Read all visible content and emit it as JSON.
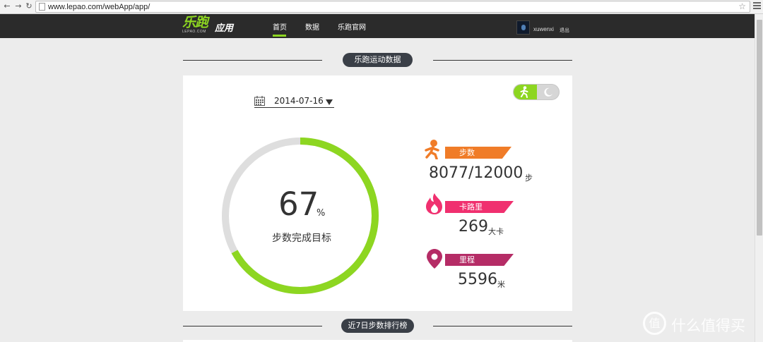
{
  "browser": {
    "url": "www.lepao.com/webApp/app/"
  },
  "header": {
    "logo_main": "乐跑",
    "logo_sub": "LEPAO.COM",
    "logo_app": "应用",
    "nav": [
      {
        "label": "首页",
        "active": true
      },
      {
        "label": "数据",
        "active": false
      },
      {
        "label": "乐跑官网",
        "active": false
      }
    ],
    "username": "xuwenxi",
    "logout_label": "退出"
  },
  "section1": {
    "title": "乐跑运动数据"
  },
  "card": {
    "date": "2014-07-16",
    "progress": {
      "value": "67",
      "unit": "%",
      "fraction": 0.67,
      "label": "步数完成目标"
    },
    "stats": [
      {
        "label": "步数",
        "value": "8077/12000",
        "unit": "步",
        "color": "#f07c28",
        "icon": "runner-icon"
      },
      {
        "label": "卡路里",
        "value": "269",
        "unit": "大卡",
        "color": "#f0306f",
        "icon": "flame-icon"
      },
      {
        "label": "里程",
        "value": "5596",
        "unit": "米",
        "color": "#b52c66",
        "icon": "location-pin-icon"
      }
    ]
  },
  "section2": {
    "title": "近7日步数排行榜"
  },
  "watermark": {
    "text": "什么值得买",
    "symbol": "值"
  },
  "colors": {
    "accent": "#8dd621",
    "header_bg": "#2b2b2b",
    "page_bg": "#ececec",
    "ring_track": "#dedede"
  }
}
